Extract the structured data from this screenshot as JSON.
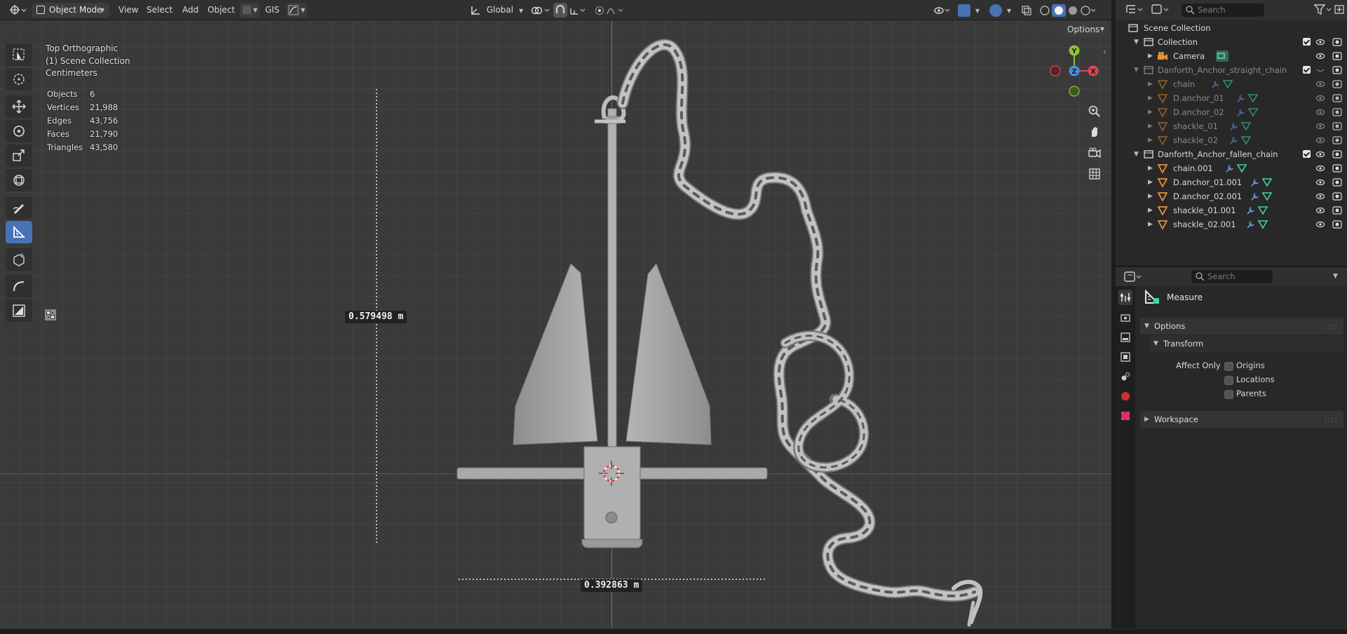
{
  "header": {
    "mode_label": "Object Mode",
    "menus": [
      "View",
      "Select",
      "Add",
      "Object"
    ],
    "gis_label": "GIS",
    "orientation_label": "Global"
  },
  "viewport": {
    "view_name": "Top Orthographic",
    "collection_info": "(1) Scene Collection",
    "units": "Centimeters",
    "options_label": "Options",
    "stats": [
      {
        "label": "Objects",
        "value": "6"
      },
      {
        "label": "Vertices",
        "value": "21,988"
      },
      {
        "label": "Edges",
        "value": "43,756"
      },
      {
        "label": "Faces",
        "value": "21,790"
      },
      {
        "label": "Triangles",
        "value": "43,580"
      }
    ],
    "measure_vertical": "0.579498 m",
    "measure_horizontal": "0.392863 m",
    "gizmo": {
      "x": "X",
      "y": "Y",
      "z": "Z"
    },
    "colors": {
      "x_axis": "#9b3a3a",
      "y_axis": "#5d8b2f",
      "active_tool": "#4772b3"
    }
  },
  "outliner": {
    "search_placeholder": "Search",
    "rows": [
      {
        "label": "Scene Collection",
        "type": "scene"
      },
      {
        "label": "Collection",
        "type": "collection"
      },
      {
        "label": "Camera",
        "type": "camera"
      },
      {
        "label": "Danforth_Anchor_straight_chain",
        "type": "collection",
        "dim": true
      },
      {
        "label": "chain",
        "type": "mesh",
        "dim": true
      },
      {
        "label": "D.anchor_01",
        "type": "mesh",
        "dim": true
      },
      {
        "label": "D.anchor_02",
        "type": "mesh",
        "dim": true
      },
      {
        "label": "shackle_01",
        "type": "mesh",
        "dim": true
      },
      {
        "label": "shackle_02",
        "type": "mesh",
        "dim": true
      },
      {
        "label": "Danforth_Anchor_fallen_chain",
        "type": "collection"
      },
      {
        "label": "chain.001",
        "type": "mesh"
      },
      {
        "label": "D.anchor_01.001",
        "type": "mesh"
      },
      {
        "label": "D.anchor_02.001",
        "type": "mesh"
      },
      {
        "label": "shackle_01.001",
        "type": "mesh"
      },
      {
        "label": "shackle_02.001",
        "type": "mesh"
      }
    ]
  },
  "properties": {
    "search_placeholder": "Search",
    "tool_name": "Measure",
    "options_label": "Options",
    "transform_label": "Transform",
    "affect_only_label": "Affect Only",
    "affect_options": [
      "Origins",
      "Locations",
      "Parents"
    ],
    "workspace_label": "Workspace"
  }
}
